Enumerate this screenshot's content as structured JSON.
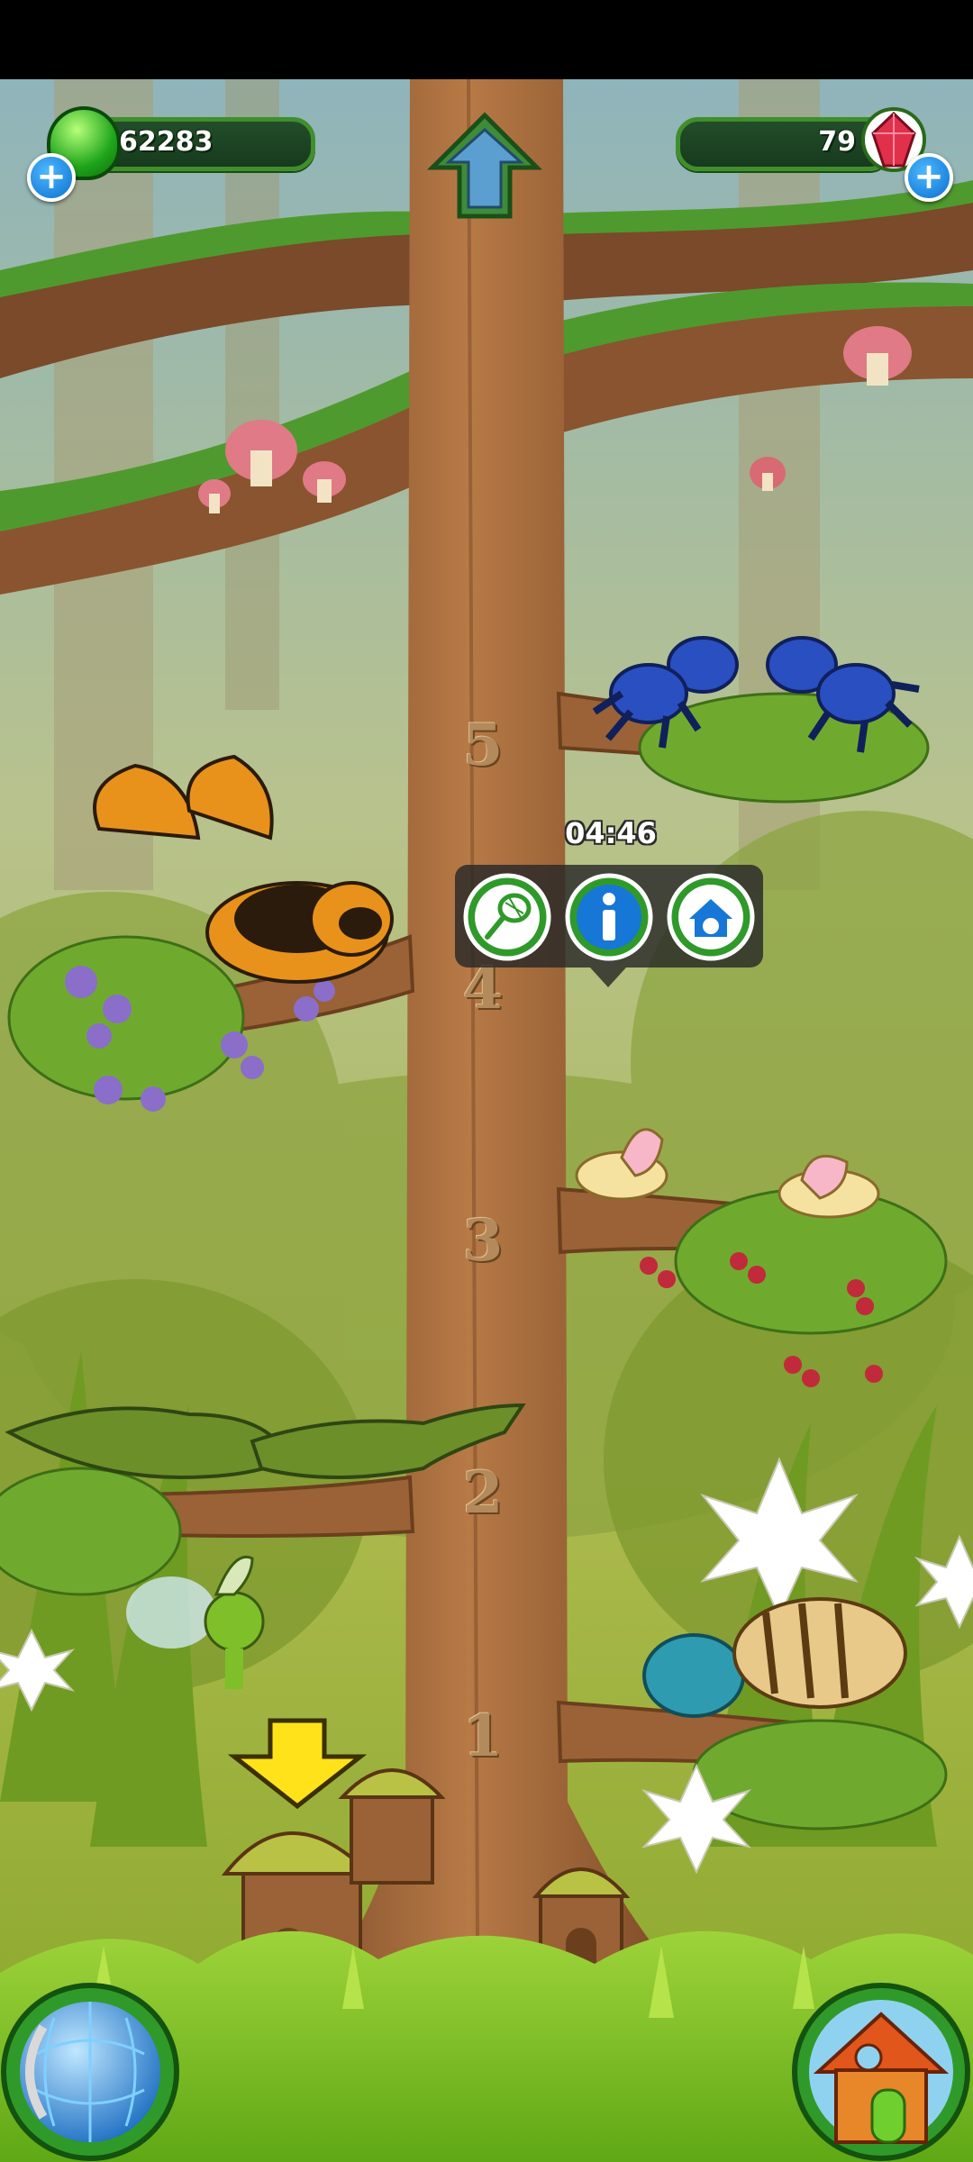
{
  "hud": {
    "gems_value": "62283",
    "crystals_value": "79",
    "gems_plus_icon": "plus-icon",
    "crystals_plus_icon": "plus-icon"
  },
  "tree": {
    "branch_numbers": [
      "5",
      "4",
      "3",
      "2",
      "1"
    ]
  },
  "popup": {
    "timer": "04:46",
    "buttons": [
      "catch-net-icon",
      "info-icon",
      "house-icon"
    ]
  },
  "colors": {
    "hud_green": "#3f8f2a",
    "info_blue": "#1677d6",
    "trunk": "#a06b3e"
  }
}
